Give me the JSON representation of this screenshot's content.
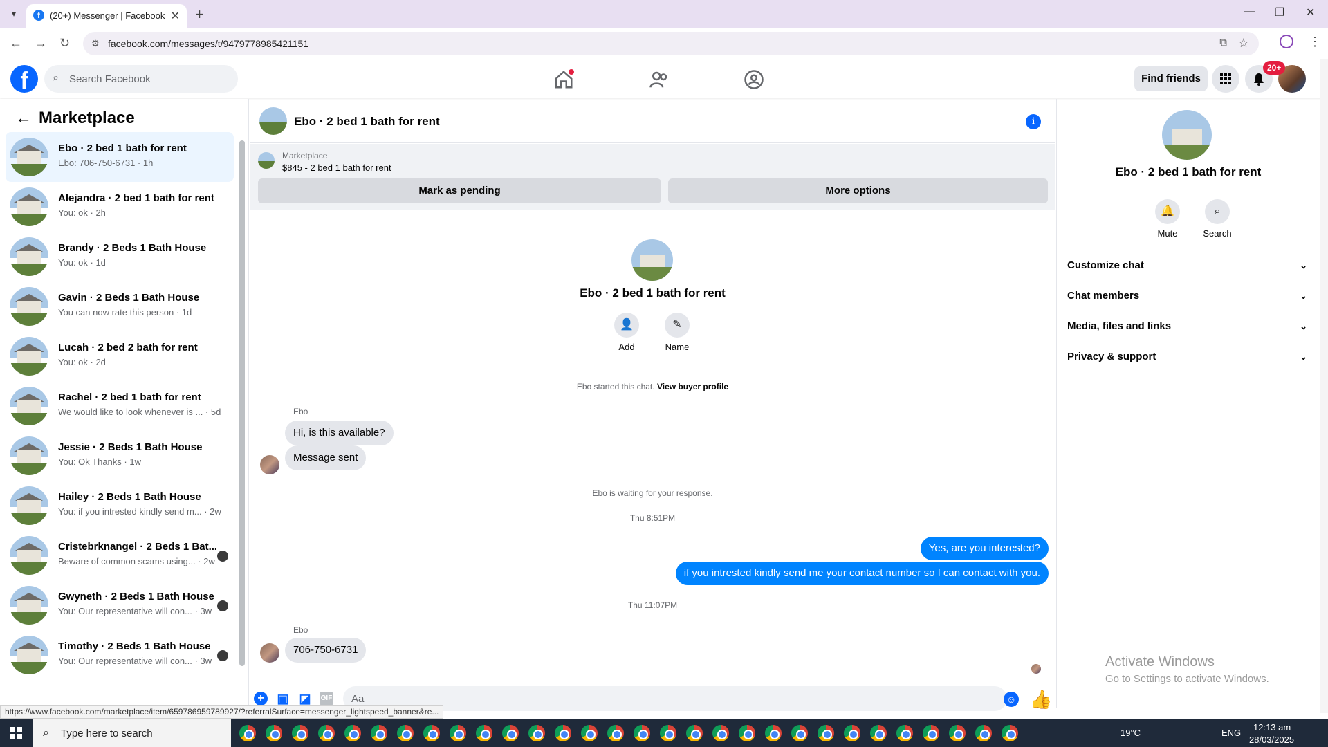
{
  "browser": {
    "tab_title": "(20+) Messenger | Facebook",
    "url": "facebook.com/messages/t/9479778985421151",
    "status_link": "https://www.facebook.com/marketplace/item/659786959789927/?referralSurface=messenger_lightspeed_banner&re..."
  },
  "fb": {
    "logo": "f",
    "search_placeholder": "Search Facebook",
    "find_friends": "Find friends",
    "notif_badge": "20+"
  },
  "sidebar": {
    "title": "Marketplace",
    "conversations": [
      {
        "name": "Ebo · 2 bed 1 bath for rent",
        "snippet": "Ebo: 706-750-6731 · 1h"
      },
      {
        "name": "Alejandra · 2 bed 1 bath for rent",
        "snippet": "You: ok · 2h"
      },
      {
        "name": "Brandy · 2 Beds 1 Bath House",
        "snippet": "You: ok · 1d"
      },
      {
        "name": "Gavin · 2 Beds 1 Bath House",
        "snippet": "You can now rate this person · 1d"
      },
      {
        "name": "Lucah · 2 bed 2 bath for rent",
        "snippet": "You: ok · 2d"
      },
      {
        "name": "Rachel · 2 bed 1 bath for rent",
        "snippet": "We would like to look whenever is ... · 5d"
      },
      {
        "name": "Jessie · 2 Beds 1 Bath House",
        "snippet": "You: Ok Thanks · 1w"
      },
      {
        "name": "Hailey · 2 Beds 1 Bath House",
        "snippet": "You: if you intrested kindly send m... · 2w"
      },
      {
        "name": "Cristebrknangel · 2 Beds 1 Bat...",
        "snippet": "Beware of common scams using... · 2w"
      },
      {
        "name": "Gwyneth · 2 Beds 1 Bath House",
        "snippet": "You: Our representative will con... · 3w"
      },
      {
        "name": "Timothy · 2 Beds 1 Bath House",
        "snippet": "You: Our representative will con... · 3w"
      }
    ]
  },
  "chat": {
    "title": "Ebo · 2 bed 1 bath for rent",
    "marketplace_label": "Marketplace",
    "listing": "$845 - 2 bed 1 bath for rent",
    "mark_pending": "Mark as pending",
    "more_options": "More options",
    "center_title": "Ebo · 2 bed 1 bath for rent",
    "add_label": "Add",
    "name_label": "Name",
    "started_text": "Ebo started this chat.",
    "view_buyer": "View buyer profile",
    "sender1": "Ebo",
    "msg1": "Hi, is this available?",
    "msg2": "Message sent",
    "waiting": "Ebo is waiting for your response.",
    "time1": "Thu 8:51PM",
    "out1": "Yes, are you interested?",
    "out2": "if you intrested kindly send me your contact number so I can contact with you.",
    "time2": "Thu 11:07PM",
    "sender2": "Ebo",
    "msg3": "706-750-6731",
    "composer_placeholder": "Aa"
  },
  "right_panel": {
    "title": "Ebo · 2 bed 1 bath for rent",
    "mute": "Mute",
    "search": "Search",
    "sections": [
      "Customize chat",
      "Chat members",
      "Media, files and links",
      "Privacy & support"
    ]
  },
  "watermark": {
    "line1": "Activate Windows",
    "line2": "Go to Settings to activate Windows."
  },
  "taskbar": {
    "search_placeholder": "Type here to search",
    "temp": "19°C",
    "lang": "ENG",
    "time": "12:13 am",
    "date": "28/03/2025"
  },
  "colors": {
    "fb_blue": "#0866ff",
    "out_bubble": "#0084ff",
    "notif_red": "#e41e3f"
  }
}
